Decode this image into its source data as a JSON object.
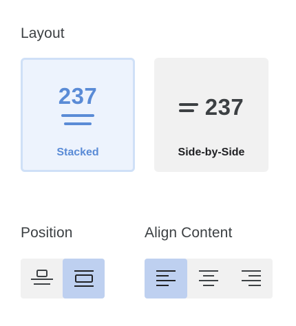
{
  "layout": {
    "title": "Layout",
    "options": [
      {
        "number": "237",
        "label": "Stacked",
        "selected": true
      },
      {
        "number": "237",
        "label": "Side-by-Side",
        "selected": false
      }
    ]
  },
  "position": {
    "title": "Position",
    "options": [
      {
        "icon": "align-vertical-top-icon",
        "selected": false
      },
      {
        "icon": "align-vertical-center-icon",
        "selected": true
      }
    ]
  },
  "align_content": {
    "title": "Align Content",
    "options": [
      {
        "icon": "align-left-icon",
        "selected": true
      },
      {
        "icon": "align-center-icon",
        "selected": false
      },
      {
        "icon": "align-right-icon",
        "selected": false
      }
    ]
  },
  "colors": {
    "accent": "#5a8bd6",
    "selected_bg": "#edf3fd",
    "selected_border": "#cfe0f7",
    "button_active_bg": "#bed0f0",
    "control_bg": "#f1f1f1"
  }
}
